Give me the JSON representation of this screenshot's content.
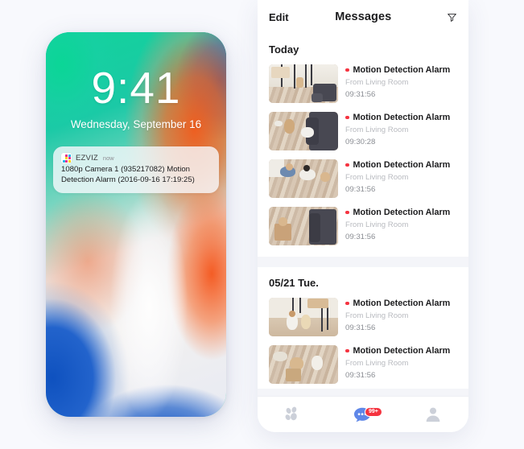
{
  "phone": {
    "lockscreen": {
      "time": "9:41",
      "date": "Wednesday, September 16",
      "wallpaper_colors": {
        "green": "#12d39b",
        "orange": "#f55814",
        "navy": "#1e3e8c",
        "blue": "#0a4ebe",
        "white": "#ffffff"
      }
    },
    "notification": {
      "app_name": "EZVIZ",
      "time_label": "now",
      "body": "1080p Camera 1 (935217082) Motion Detection Alarm (2016-09-16 17:19:25)",
      "icon": "ezviz-logo-icon",
      "logo_tiles": [
        "#ffffff",
        "#e8318c",
        "#24b7e8",
        "#ffffff",
        "#ffd200",
        "#e8318c",
        "#24b7e8",
        "#e8318c",
        "#ffd200"
      ]
    }
  },
  "app": {
    "navbar": {
      "edit_label": "Edit",
      "title": "Messages",
      "filter_icon": "filter-funnel-icon"
    },
    "accent_colors": {
      "unread_dot": "#f53340",
      "badge": "#f5333f",
      "tab_active": "#5f87e8",
      "tab_inactive": "#c7cbd4"
    },
    "sections": [
      {
        "title": "Today",
        "messages": [
          {
            "title": "Motion Detection Alarm",
            "from": "From Living Room",
            "time": "09:31:56",
            "thumb": "living-room-window-sofa",
            "unread": true
          },
          {
            "title": "Motion Detection Alarm",
            "from": "From Living Room",
            "time": "09:30:28",
            "thumb": "two-dogs-on-floor",
            "unread": true
          },
          {
            "title": "Motion Detection Alarm",
            "from": "From Living Room",
            "time": "09:31:56",
            "thumb": "family-playing-floor",
            "unread": true
          },
          {
            "title": "Motion Detection Alarm",
            "from": "From Living Room",
            "time": "09:31:56",
            "thumb": "child-with-box-sofa",
            "unread": true
          }
        ]
      },
      {
        "title": "05/21 Tue.",
        "messages": [
          {
            "title": "Motion Detection Alarm",
            "from": "From Living Room",
            "time": "09:31:56",
            "thumb": "two-children-standing",
            "unread": true
          },
          {
            "title": "Motion Detection Alarm",
            "from": "From Living Room",
            "time": "09:31:56",
            "thumb": "children-playing-floor",
            "unread": true
          }
        ]
      }
    ],
    "tabbar": {
      "items": [
        {
          "name": "devices",
          "icon": "devices-paws-icon",
          "active": false,
          "badge": null
        },
        {
          "name": "messages",
          "icon": "chat-bubble-icon",
          "active": true,
          "badge": "99+"
        },
        {
          "name": "profile",
          "icon": "person-icon",
          "active": false,
          "badge": null
        }
      ]
    }
  }
}
